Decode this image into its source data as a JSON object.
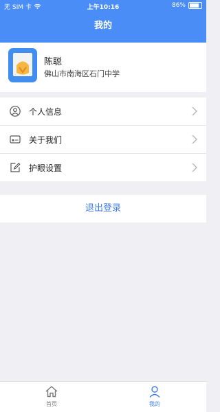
{
  "status_bar": {
    "carrier": "无 SIM 卡",
    "time": "上午10:16",
    "battery": "86%",
    "battery_level": 0.86
  },
  "header": {
    "title": "我的"
  },
  "profile": {
    "name": "陈聪",
    "school": "佛山市南海区石门中学"
  },
  "menu": [
    {
      "label": "个人信息",
      "icon": "user-icon"
    },
    {
      "label": "关于我们",
      "icon": "card-icon"
    },
    {
      "label": "护眼设置",
      "icon": "edit-icon"
    }
  ],
  "logout_label": "退出登录",
  "tabbar": {
    "home_label": "首页",
    "me_label": "我的",
    "active": "me"
  },
  "colors": {
    "primary": "#4a8df6",
    "link": "#3d7be8",
    "background": "#efeff4"
  }
}
